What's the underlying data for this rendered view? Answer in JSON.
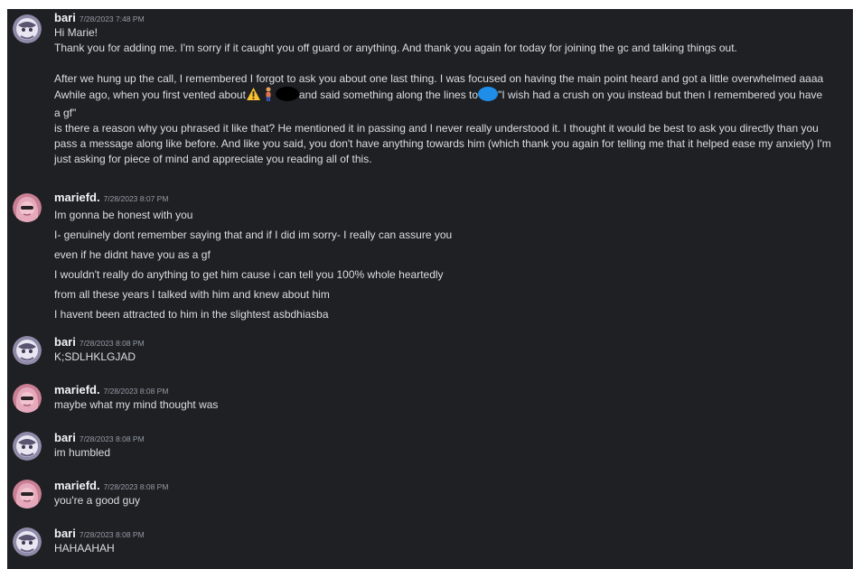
{
  "users": {
    "bari": {
      "name": "bari"
    },
    "marie": {
      "name": "mariefd."
    }
  },
  "icons": {
    "warning": "warning-icon",
    "person": "person-icon"
  },
  "colors": {
    "background": "#1f2024",
    "text": "#dbdee1",
    "username": "#f2f3f5",
    "timestamp": "#949ba4",
    "redact_blue": "#1e8ee8"
  },
  "messages": [
    {
      "author": "bari",
      "timestamp": "7/28/2023 7:48 PM",
      "lines": [
        "Hi Marie!",
        "Thank you for adding me. I'm sorry if it caught you off guard or anything. And thank you again for today for joining the gc and talking things out.",
        "",
        "After we hung up the call, I remembered I forgot to ask you about one last thing. I was focused on having the main point heard and got a little overwhelmed aaaa",
        {
          "a": "Awhile ago, when you first vented about",
          "b": "and said something along the lines to",
          "c": "\"I wish had a crush on you instead but then I remembered you have"
        },
        "a gf\"",
        "is there a reason why you phrased it like that? He mentioned it in passing and I never really understood it. I thought it would be best to ask you directly than you",
        "pass a message along like before. And like you said, you don't have anything towards him (which thank you again for telling me that it helped ease my anxiety) I'm",
        "just asking for piece of mind and appreciate you reading all of this."
      ]
    },
    {
      "author": "mariefd.",
      "timestamp": "7/28/2023 8:07 PM",
      "lines": [
        "Im gonna be honest with you",
        "I- genuinely dont remember saying that and if I did im sorry- I really can assure you",
        "even if he didnt have you as a gf",
        "I wouldn't really do anything to get him cause i can tell you 100% whole heartedly",
        "from all these years I talked with him and knew about him",
        "I havent been attracted to him in the slightest asbdhiasba"
      ]
    },
    {
      "author": "bari",
      "timestamp": "7/28/2023 8:08 PM",
      "lines": [
        "K;SDLHKLGJAD"
      ]
    },
    {
      "author": "mariefd.",
      "timestamp": "7/28/2023 8:08 PM",
      "lines": [
        "maybe what my mind thought was"
      ]
    },
    {
      "author": "bari",
      "timestamp": "7/28/2023 8:08 PM",
      "lines": [
        "im humbled"
      ]
    },
    {
      "author": "mariefd.",
      "timestamp": "7/28/2023 8:08 PM",
      "lines": [
        "you're a good guy"
      ]
    },
    {
      "author": "bari",
      "timestamp": "7/28/2023 8:08 PM",
      "lines": [
        "HAHAAHAH"
      ]
    }
  ]
}
